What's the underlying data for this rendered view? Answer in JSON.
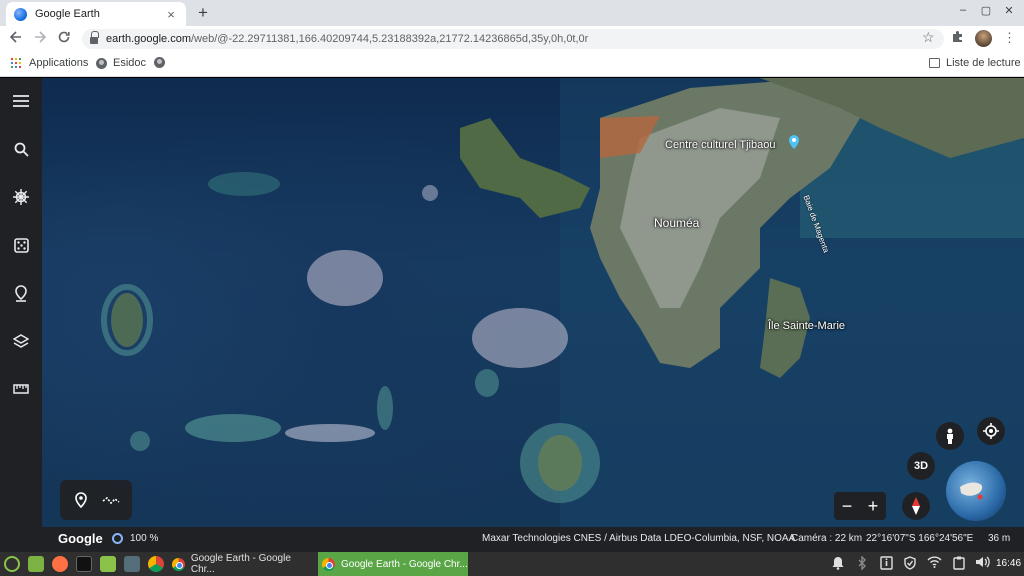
{
  "browser": {
    "tab_title": "Google Earth",
    "tab_close": "×",
    "new_tab": "+",
    "url_host": "earth.google.com",
    "url_path": "/web/@-22.29711381,166.40209744,5.23188392a,21772.14236865d,35y,0h,0t,0r",
    "window_minimize": "–",
    "window_restore": "▢",
    "window_close": "✕",
    "bookmarks": {
      "apps": "Applications",
      "esidoc": "Esidoc",
      "reading_list": "Liste de lecture"
    }
  },
  "map": {
    "labels": {
      "tjibaou": "Centre culturel Tjibaou",
      "noumea": "Nouméa",
      "magenta": "Baie de Magenta",
      "sainte_marie": "Île Sainte-Marie"
    },
    "buttons": {
      "three_d": "3D",
      "zoom_out": "−",
      "zoom_in": "+"
    }
  },
  "status": {
    "google": "Google",
    "zoom": "100 %",
    "credits": "Maxar Technologies   CNES / Airbus   Data LDEO-Columbia, NSF, NOAA",
    "camera": "Caméra : 22 km",
    "coords": "22°16'07\"S 166°24'56\"E",
    "scale": "36 m"
  },
  "taskbar": {
    "task1": "Google Earth - Google Chr...",
    "task2": "Google Earth - Google Chr...",
    "clock": "16:46"
  },
  "colors": {
    "sidebar": "#202124",
    "accent": "#1a73e8",
    "active_task": "#5aa646"
  }
}
